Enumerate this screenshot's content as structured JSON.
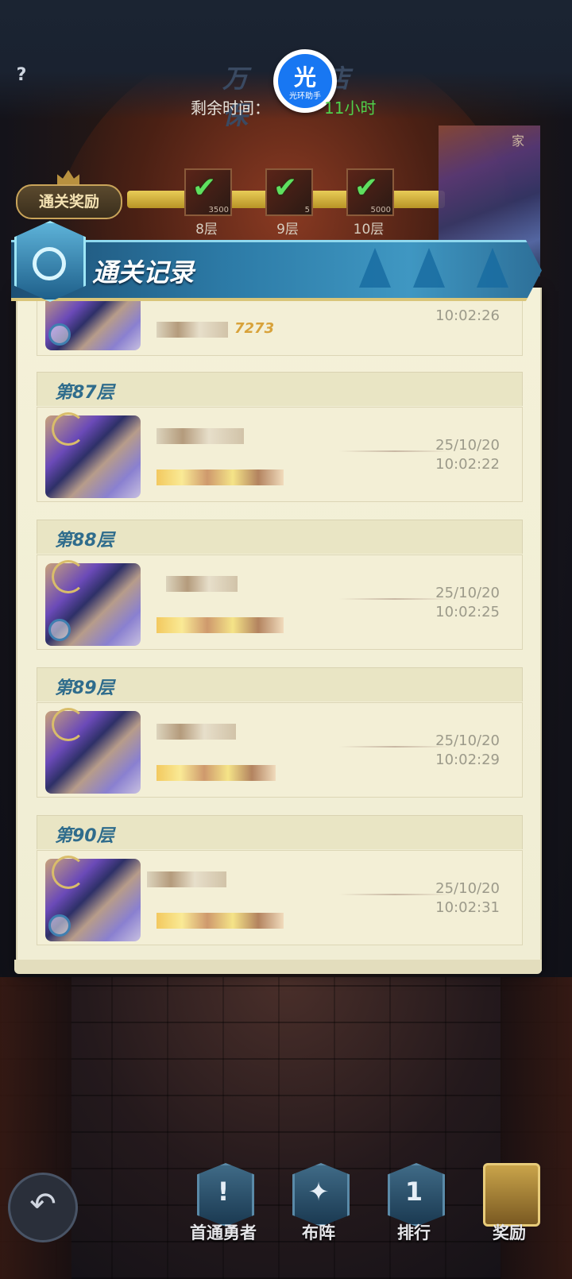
{
  "header": {
    "help": "?",
    "title_left": "万保",
    "title_right": "店",
    "timer_label": "剩余时间：",
    "timer_value": "11小时"
  },
  "logo": {
    "glyph": "光",
    "caption": "光环助手"
  },
  "rewards": {
    "label": "通关奖励",
    "nodes": [
      {
        "floor": "8层",
        "count": "3500"
      },
      {
        "floor": "9层",
        "count": "5"
      },
      {
        "floor": "10层",
        "count": "5000"
      }
    ]
  },
  "top_right_label": "家",
  "record_panel": {
    "title": "通关记录",
    "partial": {
      "power": "7273",
      "time": "10:02:26"
    },
    "records": [
      {
        "floor": "第87层",
        "date": "25/10/20",
        "time": "10:02:22"
      },
      {
        "floor": "第88层",
        "date": "25/10/20",
        "time": "10:02:25"
      },
      {
        "floor": "第89层",
        "date": "25/10/20",
        "time": "10:02:29"
      },
      {
        "floor": "第90层",
        "date": "25/10/20",
        "time": "10:02:31"
      }
    ]
  },
  "nav": {
    "back": "↶",
    "items": [
      {
        "label": "首通勇者",
        "glyph": "!"
      },
      {
        "label": "布阵",
        "glyph": "✦"
      },
      {
        "label": "排行",
        "glyph": "1"
      },
      {
        "label": "奖励",
        "glyph": ""
      }
    ]
  }
}
